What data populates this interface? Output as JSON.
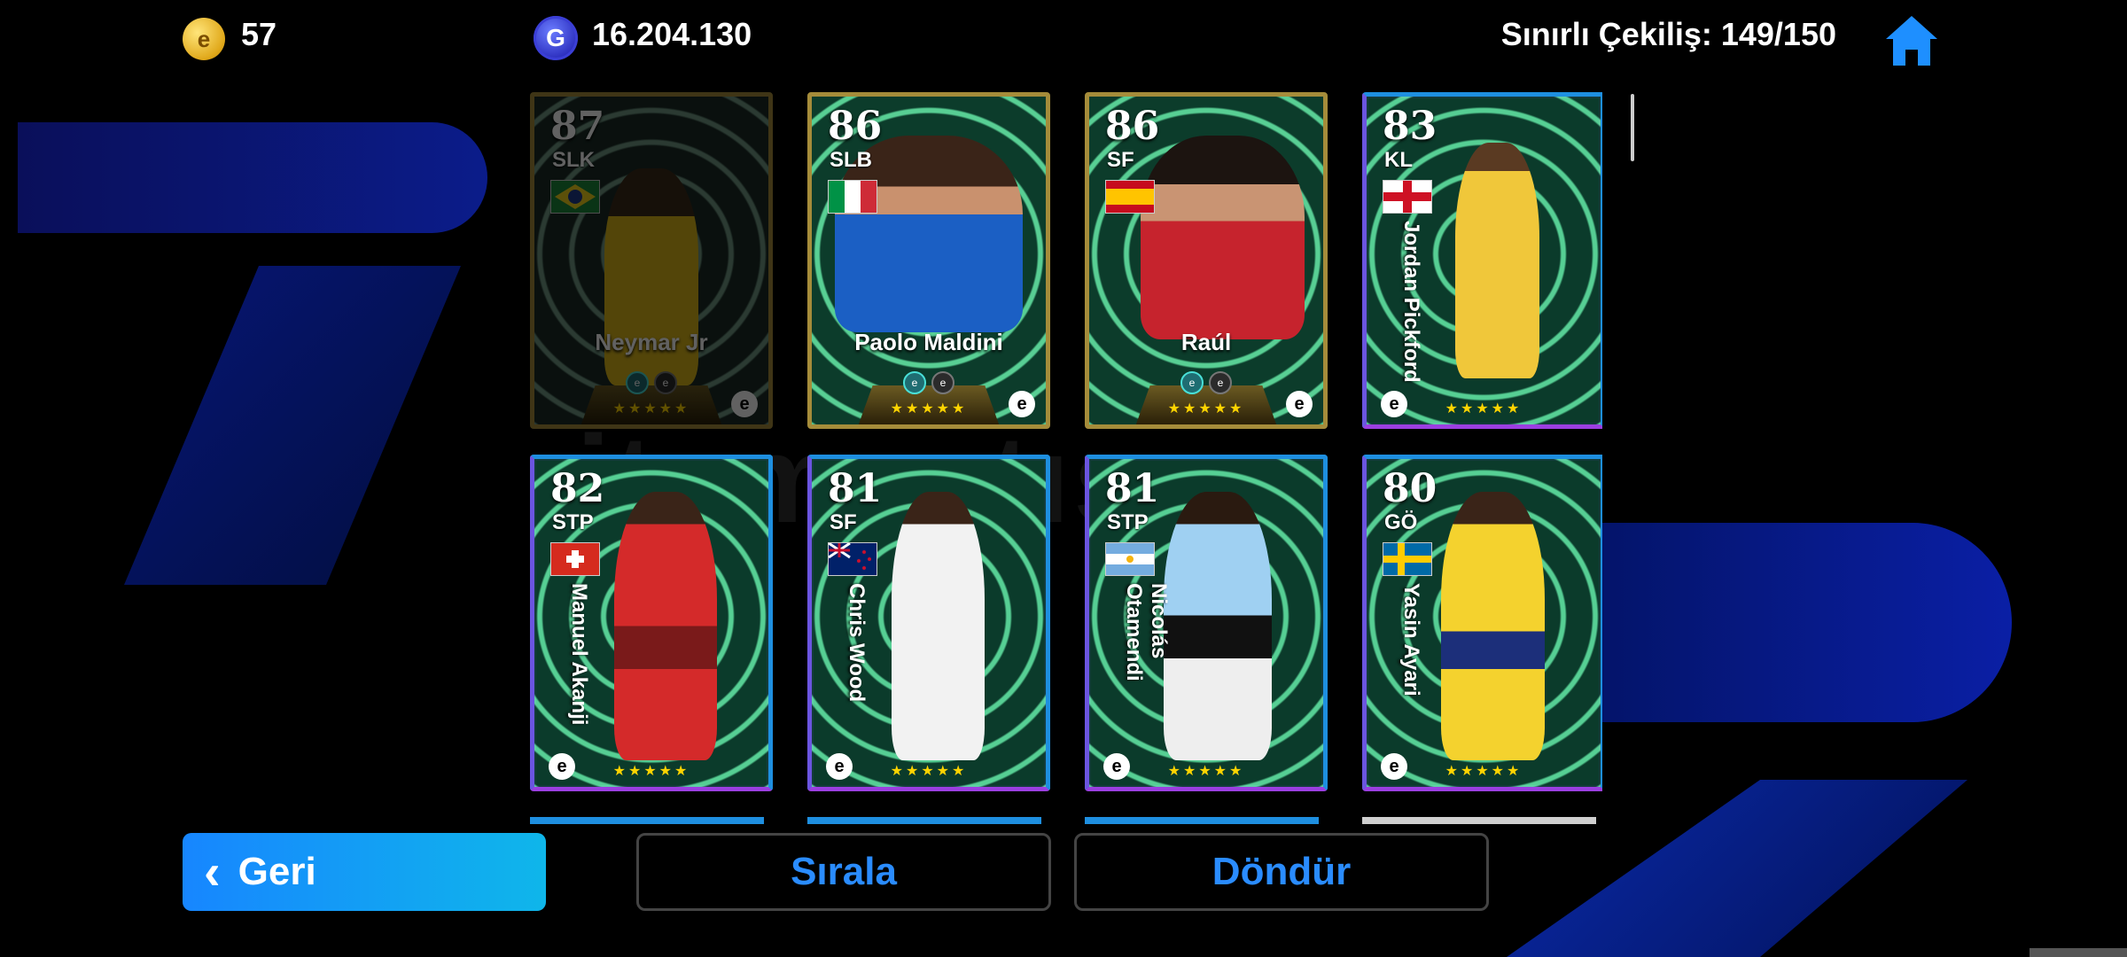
{
  "topbar": {
    "coins": "57",
    "gp": "16.204.130",
    "draw_limit": "Sınırlı Çekiliş: 149/150",
    "coin_icon": "e-coin-icon",
    "gp_icon": "gp-icon",
    "home_icon": "home-icon"
  },
  "cards": [
    {
      "rating": "87",
      "position": "SLK",
      "name": "Neymar Jr",
      "flag": "brazil",
      "style": "gold",
      "dimmed": true
    },
    {
      "rating": "86",
      "position": "SLB",
      "name": "Paolo Maldini",
      "flag": "italy",
      "style": "gold"
    },
    {
      "rating": "86",
      "position": "SF",
      "name": "Raúl",
      "flag": "spain",
      "style": "gold"
    },
    {
      "rating": "83",
      "position": "KL",
      "name": "Jordan Pickford",
      "flag": "england",
      "style": "blue"
    },
    {
      "rating": "82",
      "position": "STP",
      "name": "Manuel Akanji",
      "flag": "switzerland",
      "style": "blue"
    },
    {
      "rating": "81",
      "position": "SF",
      "name": "Chris Wood",
      "flag": "new-zealand",
      "style": "blue"
    },
    {
      "rating": "81",
      "position": "STP",
      "name": "Nicolás Otamendi",
      "flag": "argentina",
      "style": "blue"
    },
    {
      "rating": "80",
      "position": "GÖ",
      "name": "Yasin Ayari",
      "flag": "sweden",
      "style": "blue"
    }
  ],
  "buttons": {
    "back": "Geri",
    "sort": "Sırala",
    "rotate": "Döndür"
  },
  "colors": {
    "accent_blue": "#2a8cff",
    "gold_border": "#a58c3a",
    "blue_border": "#1e8fe0"
  }
}
